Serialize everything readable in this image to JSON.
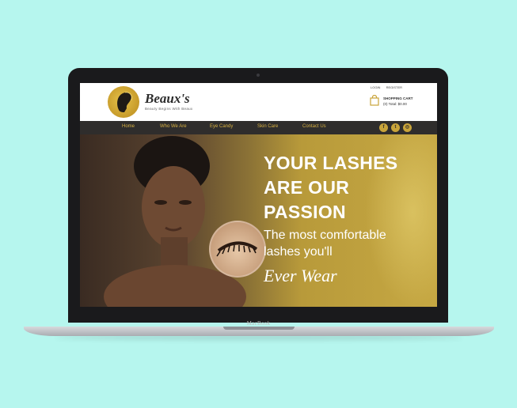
{
  "device": {
    "brand_label": "MacBook"
  },
  "site": {
    "logo_text": "Beaux's",
    "tagline": "Beauty Begins With Beaux",
    "top_links": {
      "login": "LOGIN",
      "register": "REGISTER"
    },
    "cart": {
      "title": "SHOPPING CART",
      "summary": "(0) Total: $0.00",
      "icon": "shopping-bag-icon"
    },
    "nav": [
      "Home",
      "Who We Are",
      "Eye Candy",
      "Skin Care",
      "Contact Us"
    ],
    "social": [
      {
        "name": "facebook-icon",
        "glyph": "f"
      },
      {
        "name": "twitter-icon",
        "glyph": "t"
      },
      {
        "name": "instagram-icon",
        "glyph": "◎"
      }
    ]
  },
  "hero": {
    "headline": [
      "YOUR LASHES",
      "ARE OUR",
      "PASSION"
    ],
    "subline": [
      "The most comfortable",
      "lashes you'll"
    ],
    "script": "Ever Wear",
    "slider": {
      "count": 3,
      "active": 1
    }
  },
  "colors": {
    "background": "#b6f6ee",
    "accent_gold": "#c9a43a",
    "nav_bg": "#2f2d2c"
  }
}
